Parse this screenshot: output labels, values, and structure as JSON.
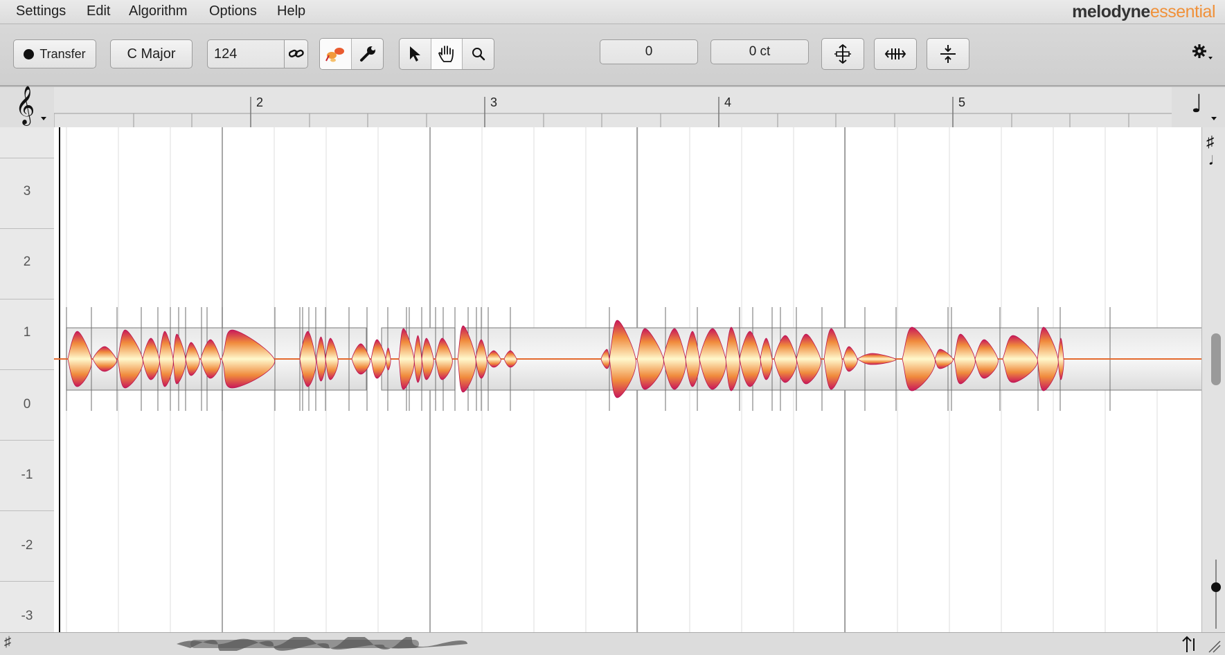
{
  "menu": {
    "items": [
      "Settings",
      "Edit",
      "Algorithm",
      "Options",
      "Help"
    ],
    "brand_bold": "melodyne",
    "brand_light": "essential"
  },
  "toolbar": {
    "transfer_label": "Transfer",
    "scale_label": "C Major",
    "tempo_value": "124",
    "pitch_value": "0",
    "cents_value": "0 ct"
  },
  "ruler": {
    "bars": [
      "2",
      "3",
      "4",
      "5"
    ]
  },
  "pitch_axis": {
    "labels": [
      "3",
      "2",
      "1",
      "0",
      "-1",
      "-2",
      "-3"
    ]
  },
  "icons": {
    "record": "record-dot-icon",
    "link": "link-icon",
    "blob_tool": "main-tool-icon",
    "wrench": "wrench-icon",
    "pointer": "pointer-icon",
    "hand": "hand-icon",
    "zoom": "magnifier-icon",
    "gear": "gear-icon",
    "clef": "treble-clef-icon",
    "note": "quarter-note-icon"
  },
  "colors": {
    "blob_core": "#fff7c8",
    "blob_mid": "#f6a43a",
    "blob_edge": "#c8185a",
    "brand_accent": "#f0913a"
  }
}
